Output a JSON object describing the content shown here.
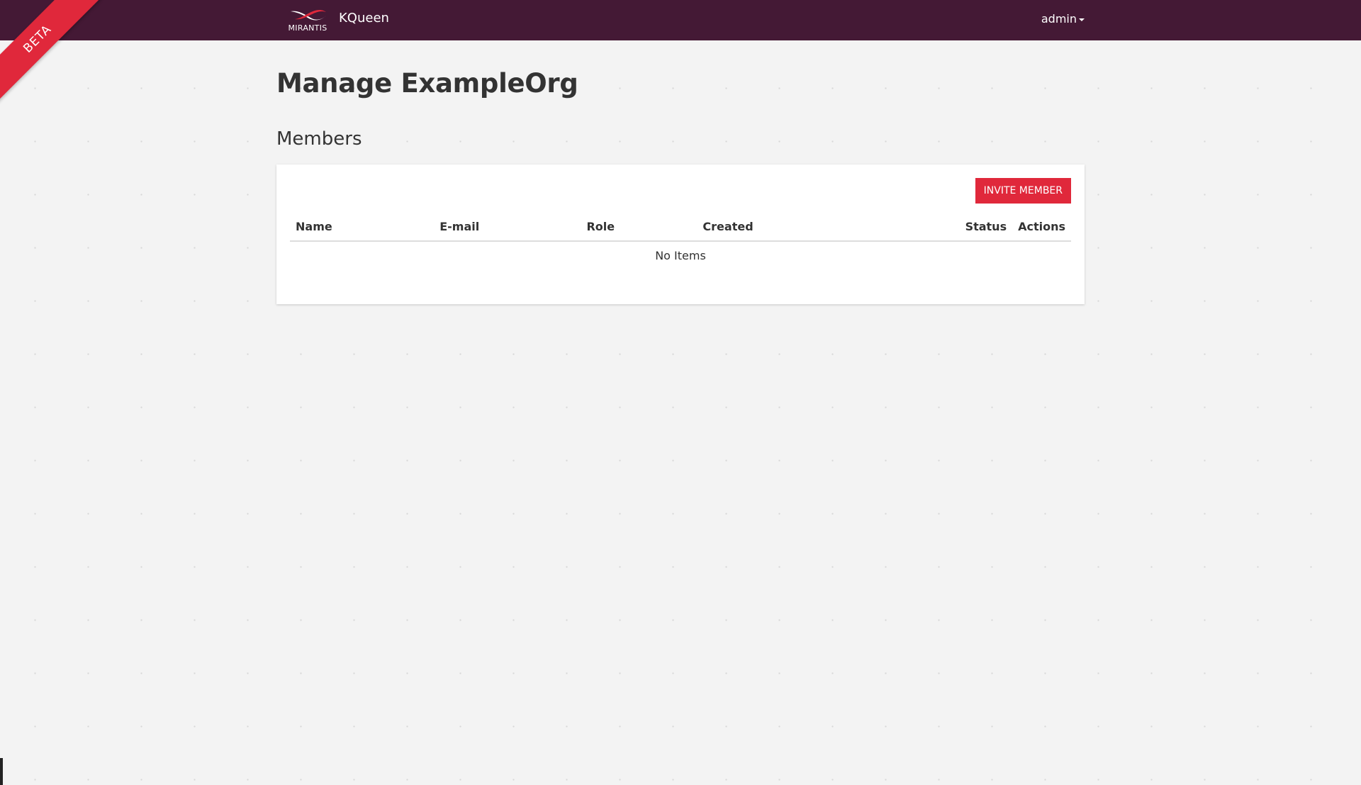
{
  "ribbon": {
    "label": "BETA"
  },
  "brand": {
    "logo_text": "MIRANTIS",
    "app_name": "KQueen"
  },
  "user_menu": {
    "label": "admin"
  },
  "page": {
    "title": "Manage ExampleOrg",
    "section_title": "Members"
  },
  "members": {
    "invite_label": "INVITE MEMBER",
    "columns": [
      "Name",
      "E-mail",
      "Role",
      "Created",
      "Status",
      "Actions"
    ],
    "empty_text": "No Items"
  },
  "colors": {
    "navbar": "#441935",
    "accent": "#e0283b",
    "background": "#f3f3f3"
  }
}
